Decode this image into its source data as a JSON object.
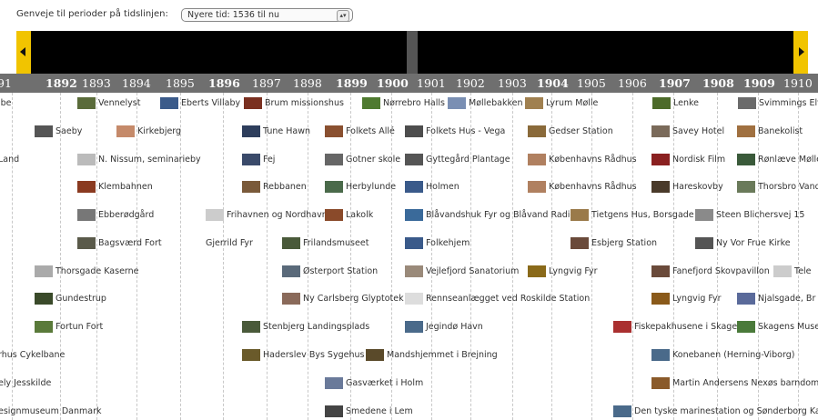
{
  "toolbar": {
    "shortcut_label": "Genveje til perioder på tidslinjen:",
    "select_value": "Nyere tid: 1536 til nu"
  },
  "years": [
    "91",
    "1892",
    "1893",
    "1894",
    "1895",
    "1896",
    "1897",
    "1898",
    "1899",
    "1900",
    "1901",
    "1902",
    "1903",
    "1904",
    "1905",
    "1906",
    "1907",
    "1908",
    "1909",
    "1910"
  ],
  "bold_years": [
    "1892",
    "1896",
    "1899",
    "1900",
    "1904",
    "1907",
    "1908",
    "1909"
  ],
  "entries": [
    "ibe",
    "Vennelyst",
    "Eberts Villaby",
    "Brum missionshus",
    "Nørrebro Halls",
    "Møllebakken",
    "Lyrum Mølle",
    "Lenke",
    "Svimmings Elve",
    "Saeby",
    "Kirkebjerg",
    "Tune Hawn",
    "Folkets Allé",
    "Folkets Hus - Vega",
    "Gedser Station",
    "Savey Hotel",
    "Banekolist",
    "Land",
    "N. Nissum, seminarieby",
    "Fej",
    "Gotner skole",
    "Gyttegård Plantage",
    "Københavns Rådhus",
    "Nordisk Film",
    "Rønlæve Mølle",
    "Klembahnen",
    "Rebbanen",
    "Herbylunde",
    "Holmen",
    "Københavns Rådhus",
    "Hareskovby",
    "Thorsbro Vand",
    "Ebberødgård",
    "Frihavnen og Nordhavnen",
    "Lakolk",
    "Blåvandshuk Fyr og Blåvand Radio",
    "Tietgens Hus, Borsgade",
    "Steen Blichersvej 15",
    "Bagsværd Fort",
    "Gjerrild Fyr",
    "Frilandsmuseet",
    "Folkehjem",
    "Esbjerg Station",
    "Ny Vor Frue Kirke",
    "Thorsgade Kaserne",
    "Østerport Station",
    "Vejlefjord Sanatorium",
    "Lyngvig Fyr",
    "Fanefjord Skovpavillon",
    "Tele",
    "Gundestrup",
    "Ny Carlsberg Glyptotek",
    "Rennseanlægget ved Roskilde Station",
    "Lyngvig Fyr",
    "Njalsgade, Br",
    "Fortun Fort",
    "Stenbjerg Landingsplads",
    "Jegindø Havn",
    "Fiskepakhusene i Skagen",
    "Skagens Museu",
    "rhus Cykelbane",
    "Haderslev Bys Sygehus",
    "Mandshjemmet i Brejning",
    "Konebanen (Herning-Viborg)",
    "ely Jesskilde",
    "Gasværket i Holm",
    "Martin Andersens Nexøs barndomsl",
    "esignmuseum Danmark",
    "Smedene i Lem",
    "Den tyske marinestation og Sønderborg Kaser"
  ]
}
